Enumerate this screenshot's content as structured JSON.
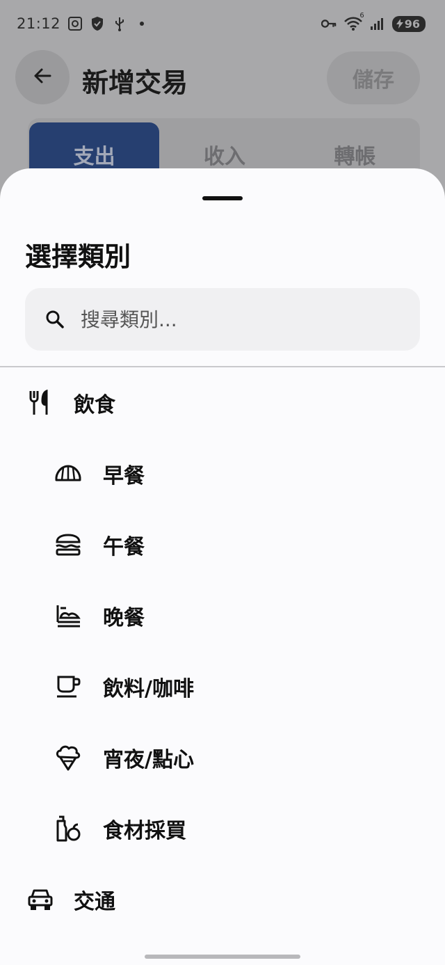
{
  "status_bar": {
    "time": "21:12",
    "battery": "96",
    "wifi_badge": "6",
    "icons": [
      "screenshot-icon",
      "shield-icon",
      "usb-icon",
      "key-icon",
      "wifi-icon",
      "signal-icon",
      "battery-icon"
    ]
  },
  "app_bar": {
    "title": "新增交易",
    "save_label": "儲存"
  },
  "tabs": [
    {
      "label": "支出",
      "active": true
    },
    {
      "label": "收入",
      "active": false
    },
    {
      "label": "轉帳",
      "active": false
    }
  ],
  "sheet": {
    "title": "選擇類別",
    "search_placeholder": "搜尋類別...",
    "categories": [
      {
        "label": "飲食",
        "icon": "utensils-icon",
        "level": "parent"
      },
      {
        "label": "早餐",
        "icon": "croissant-icon",
        "level": "child"
      },
      {
        "label": "午餐",
        "icon": "burger-icon",
        "level": "child"
      },
      {
        "label": "晚餐",
        "icon": "dinner-icon",
        "level": "child"
      },
      {
        "label": "飲料/咖啡",
        "icon": "coffee-cup-icon",
        "level": "child"
      },
      {
        "label": "宵夜/點心",
        "icon": "ice-cream-icon",
        "level": "child"
      },
      {
        "label": "食材採買",
        "icon": "groceries-icon",
        "level": "child"
      },
      {
        "label": "交通",
        "icon": "car-icon",
        "level": "parent"
      }
    ]
  },
  "colors": {
    "scrim": "#a8a8aa",
    "tab_active": "#263f70",
    "sheet_bg": "#fbfbfd",
    "search_bg": "#f0f0f2"
  }
}
